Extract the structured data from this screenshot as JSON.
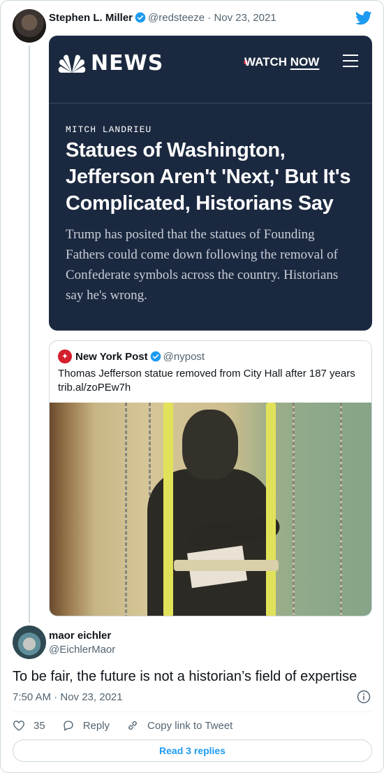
{
  "parent_tweet": {
    "author_name": "Stephen L. Miller",
    "handle": "@redsteeze",
    "date_sep": "·",
    "date": "Nov 23, 2021"
  },
  "nbc_article": {
    "brand": "NEWS",
    "watch_label": "WATCH",
    "now_label": "NOW",
    "kicker": "MITCH LANDRIEU",
    "headline": "Statues of Washington, Jefferson Aren't 'Next,' But It's Complicated, Historians Say",
    "dek": "Trump has posited that the statues of Founding Fathers could come down following the removal of Confederate symbols across the country. Historians say he's wrong."
  },
  "quoted_tweet": {
    "author_name": "New York Post",
    "handle": "@nypost",
    "text": "Thomas Jefferson statue removed from City Hall after 187 years",
    "link": "trib.al/zoPEw7h"
  },
  "reply_tweet": {
    "author_name": "maor eichler",
    "handle": "@EichlerMaor",
    "text": "To be fair, the future is not a historian’s field of expertise",
    "timestamp": "7:50 AM · Nov 23, 2021",
    "like_count": "35",
    "reply_label": "Reply",
    "copy_link_label": "Copy link to Tweet",
    "read_replies_label": "Read 3 replies"
  },
  "colors": {
    "twitter_blue": "#1d9bf0",
    "nbc_navy": "#1b2940",
    "nypost_red": "#d41f2c"
  },
  "icons": [
    "verified-badge-icon",
    "twitter-bird-icon",
    "nbc-peacock-icon",
    "menu-icon",
    "nypost-logo-icon",
    "info-icon",
    "heart-icon",
    "reply-icon",
    "link-icon"
  ]
}
